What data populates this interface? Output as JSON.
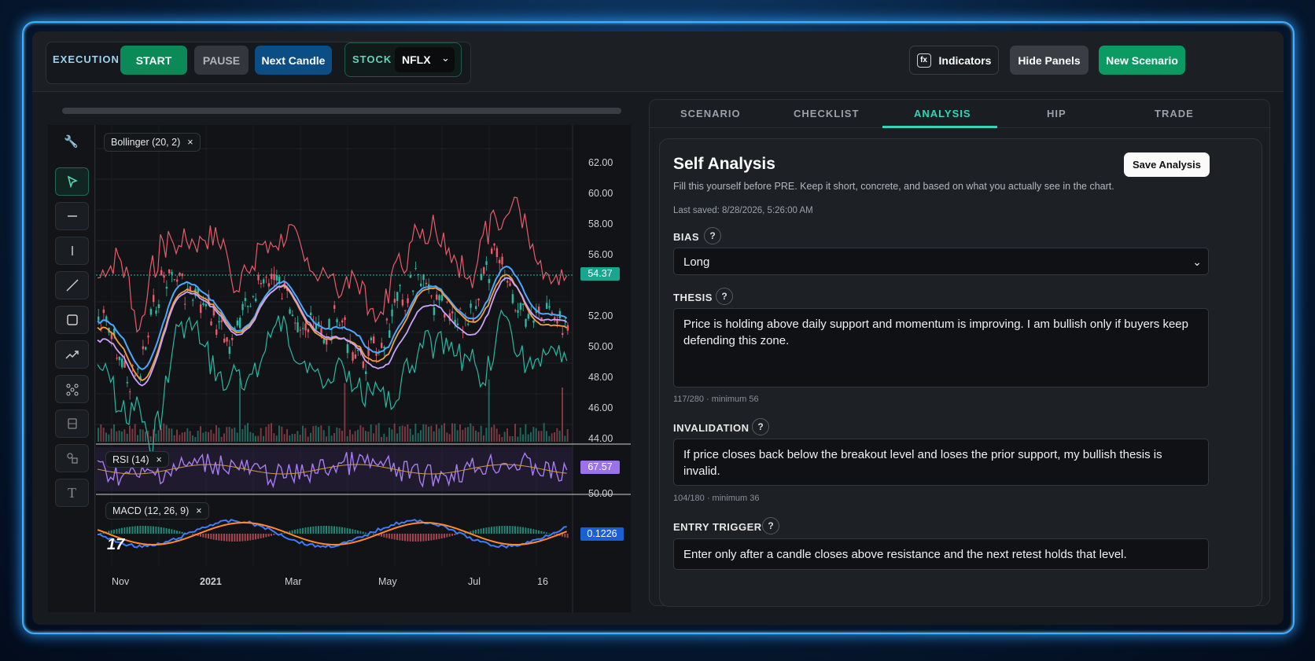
{
  "toolbar": {
    "execution_label": "EXECUTION",
    "start": "START",
    "pause": "PAUSE",
    "next_candle": "Next Candle",
    "stock_label": "STOCK",
    "stock_value": "NFLX",
    "indicators": "Indicators",
    "indicators_icon": "fx",
    "hide_panels": "Hide Panels",
    "new_scenario": "New Scenario"
  },
  "chart": {
    "bollinger_label": "Bollinger (20, 2)",
    "rsi_label": "RSI (14)",
    "macd_label": "MACD (12, 26, 9)",
    "last_price": "54.37",
    "rsi_value": "67.57",
    "rsi_level": "50.00",
    "macd_value": "0.1226",
    "price_ticks": [
      "62.00",
      "60.00",
      "58.00",
      "56.00",
      "52.00",
      "50.00",
      "48.00",
      "46.00",
      "44.00"
    ],
    "time_labels": [
      "Nov",
      "2021",
      "Mar",
      "May",
      "Jul",
      "16"
    ],
    "close_icon": "×"
  },
  "tabs": [
    "SCENARIO",
    "CHECKLIST",
    "ANALYSIS",
    "HIP",
    "TRADE"
  ],
  "analysis": {
    "title": "Self Analysis",
    "save": "Save Analysis",
    "subtitle": "Fill this yourself before PRE. Keep it short, concrete, and based on what you actually see in the chart.",
    "last_saved": "Last saved: 8/28/2026, 5:26:00 AM",
    "bias_label": "BIAS",
    "bias_value": "Long",
    "help": "?",
    "thesis_label": "THESIS",
    "thesis_value": "Price is holding above daily support and momentum is improving. I am bullish only if buyers keep defending this zone.",
    "thesis_count": "117/280 · minimum 56",
    "invalidation_label": "INVALIDATION",
    "invalidation_value": "If price closes back below the breakout level and loses the prior support, my bullish thesis is invalid.",
    "invalidation_count": "104/180 · minimum 36",
    "entry_label": "ENTRY TRIGGER",
    "entry_value": "Enter only after a candle closes above resistance and the next retest holds that level."
  },
  "colors": {
    "green": "#0b8a57",
    "blue": "#0b4e86",
    "accent": "#27c2a8",
    "rsi": "#a77cf0",
    "macd_badge": "#1a5fd6"
  }
}
